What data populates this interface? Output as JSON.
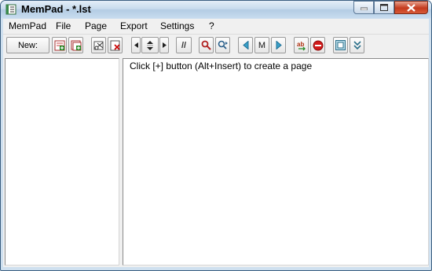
{
  "window": {
    "title": "MemPad - *.lst"
  },
  "menu": [
    "MemPad",
    "File",
    "Page",
    "Export",
    "Settings",
    "?"
  ],
  "toolbar": {
    "new_label": "New:",
    "separator_label": "//",
    "marker_label": "M"
  },
  "editor": {
    "hint": "Click [+] button (Alt+Insert) to create a page"
  },
  "colors": {
    "title_gradient": "#c5d9ec",
    "close_button": "#c43b1e",
    "go_icon": "#3aa0c8",
    "stop_icon": "#d21a1a"
  }
}
